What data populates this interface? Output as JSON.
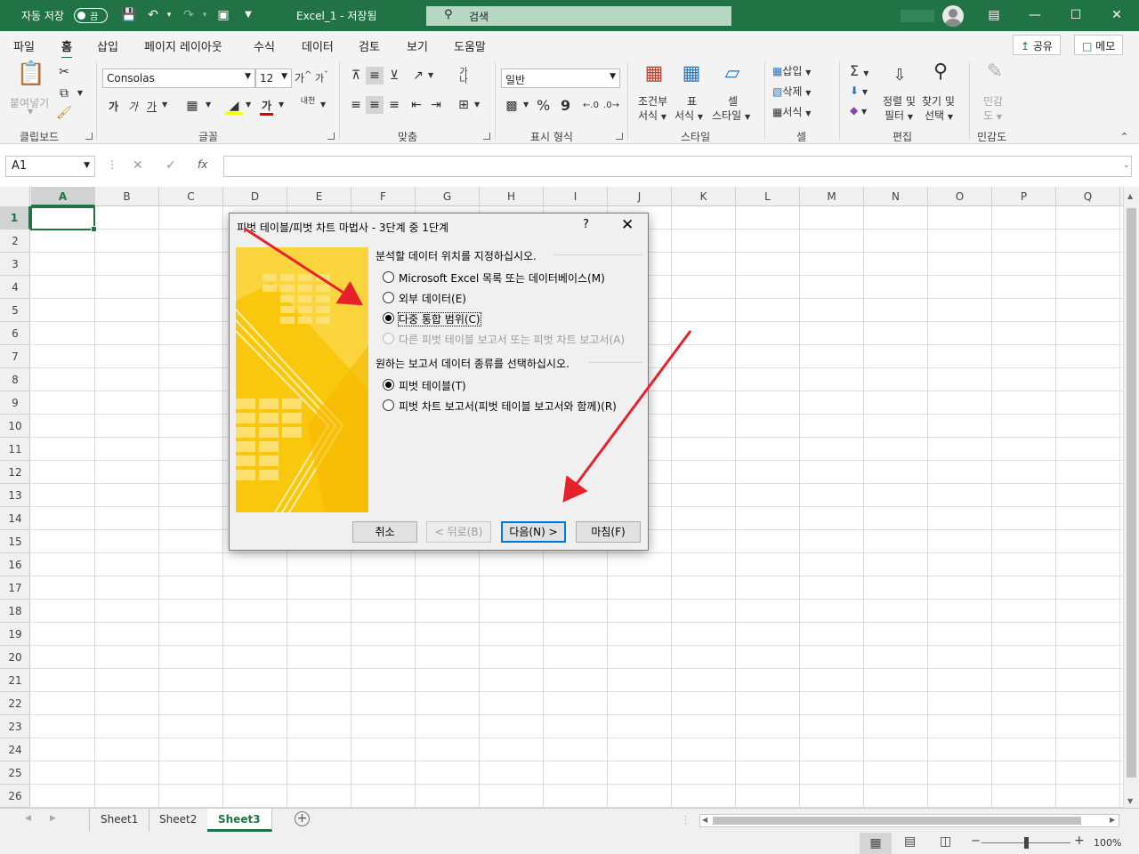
{
  "titlebar": {
    "autosave_label": "자동 저장",
    "autosave_state": "끔",
    "document_title": "Excel_1 - 저장됨",
    "search_placeholder": "검색"
  },
  "ribbon_tabs": [
    "파일",
    "홈",
    "삽입",
    "페이지 레이아웃",
    "수식",
    "데이터",
    "검토",
    "보기",
    "도움말"
  ],
  "active_tab": "홈",
  "share_label": "공유",
  "comments_label": "메모",
  "ribbon": {
    "clipboard": {
      "paste": "붙여넣기",
      "label": "클립보드"
    },
    "font": {
      "name": "Consolas",
      "size": "12",
      "bold": "가",
      "italic": "가",
      "underline": "가",
      "grow": "가",
      "shrink": "가",
      "font_color": "가",
      "phonetic": "내천",
      "label": "글꼴"
    },
    "alignment": {
      "wrap": "가나",
      "label": "맞춤"
    },
    "number": {
      "format": "일반",
      "percent": "%",
      "comma": "9",
      "label": "표시 형식"
    },
    "styles": {
      "conditional": [
        "조건부",
        "서식"
      ],
      "table": [
        "표",
        "서식"
      ],
      "cell_styles": [
        "셀",
        "스타일"
      ],
      "label": "스타일"
    },
    "cells": {
      "insert": "삽입",
      "delete": "삭제",
      "format": "서식",
      "label": "셀"
    },
    "editing": {
      "sum": "Σ",
      "sort": [
        "정렬 및",
        "필터"
      ],
      "find": [
        "찾기 및",
        "선택"
      ],
      "label": "편집"
    },
    "sensitivity": {
      "button": [
        "민감",
        "도"
      ],
      "label": "민감도"
    }
  },
  "formula_bar": {
    "name_box": "A1",
    "fx": "fx",
    "value": ""
  },
  "columns": [
    "A",
    "B",
    "C",
    "D",
    "E",
    "F",
    "G",
    "H",
    "I",
    "J",
    "K",
    "L",
    "M",
    "N",
    "O",
    "P",
    "Q"
  ],
  "rows": [
    "1",
    "2",
    "3",
    "4",
    "5",
    "6",
    "7",
    "8",
    "9",
    "10",
    "11",
    "12",
    "13",
    "14",
    "15",
    "16",
    "17",
    "18",
    "19",
    "20",
    "21",
    "22",
    "23",
    "24",
    "25",
    "26"
  ],
  "sheets": [
    "Sheet1",
    "Sheet2",
    "Sheet3"
  ],
  "active_sheet": "Sheet3",
  "status": {
    "zoom": "100%",
    "zoom_level": 100
  },
  "dialog": {
    "title": "피벗 테이블/피벗 차트 마법사 - 3단계 중 1단계",
    "help": "?",
    "close": "✕",
    "section1": "분석할 데이터 위치를 지정하십시오.",
    "source_options": [
      {
        "label": "Microsoft Excel 목록 또는 데이터베이스(M)",
        "checked": false,
        "disabled": false
      },
      {
        "label": "외부 데이터(E)",
        "checked": false,
        "disabled": false
      },
      {
        "label": "다중 통합 범위(C)",
        "checked": true,
        "disabled": false
      },
      {
        "label": "다른 피벗 테이블 보고서 또는 피벗 차트 보고서(A)",
        "checked": false,
        "disabled": true
      }
    ],
    "section2": "원하는 보고서 데이터 종류를 선택하십시오.",
    "report_options": [
      {
        "label": "피벗 테이블(T)",
        "checked": true
      },
      {
        "label": "피벗 차트 보고서(피벗 테이블 보고서와 함께)(R)",
        "checked": false
      }
    ],
    "buttons": {
      "cancel": "취소",
      "back": "< 뒤로(B)",
      "next": "다음(N) >",
      "finish": "마침(F)"
    }
  },
  "colors": {
    "excel_green": "#217346",
    "annotation_red": "#e8202a",
    "accent_yellow": "#f7c517"
  }
}
